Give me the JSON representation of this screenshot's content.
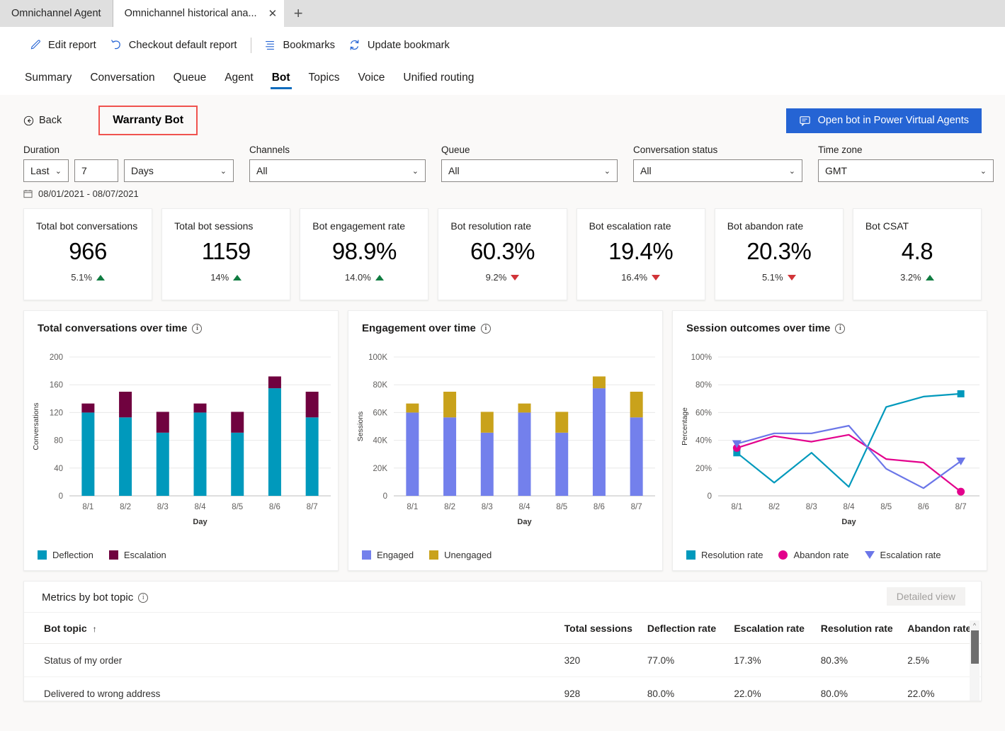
{
  "browser": {
    "tabs": [
      {
        "title": "Omnichannel Agent",
        "active": false
      },
      {
        "title": "Omnichannel historical ana...",
        "active": true
      }
    ],
    "close_glyph": "✕",
    "newtab_glyph": "+"
  },
  "commandbar": {
    "items": [
      {
        "label": "Edit report",
        "icon": "pencil-icon"
      },
      {
        "label": "Checkout default report",
        "icon": "undo-icon"
      },
      {
        "label": "Bookmarks",
        "icon": "list-icon"
      },
      {
        "label": "Update bookmark",
        "icon": "refresh-icon"
      }
    ]
  },
  "nav": {
    "tabs": [
      {
        "label": "Summary",
        "selected": false
      },
      {
        "label": "Conversation",
        "selected": false
      },
      {
        "label": "Queue",
        "selected": false
      },
      {
        "label": "Agent",
        "selected": false
      },
      {
        "label": "Bot",
        "selected": true
      },
      {
        "label": "Topics",
        "selected": false
      },
      {
        "label": "Voice",
        "selected": false
      },
      {
        "label": "Unified routing",
        "selected": false
      }
    ]
  },
  "header": {
    "back_label": "Back",
    "bot_name": "Warranty Bot",
    "open_bot_button": "Open bot in Power Virtual Agents",
    "highlight_color": "#f0534f",
    "button_color": "#2564d4"
  },
  "filters": {
    "duration": {
      "label": "Duration",
      "mode": "Last",
      "amount": "7",
      "unit": "Days"
    },
    "channels": {
      "label": "Channels",
      "value": "All"
    },
    "queue": {
      "label": "Queue",
      "value": "All"
    },
    "conversation_status": {
      "label": "Conversation status",
      "value": "All"
    },
    "time_zone": {
      "label": "Time zone",
      "value": "GMT"
    },
    "date_range": "08/01/2021 - 08/07/2021"
  },
  "kpis": [
    {
      "title": "Total bot conversations",
      "value": "966",
      "delta": "5.1%",
      "direction": "up"
    },
    {
      "title": "Total bot sessions",
      "value": "1159",
      "delta": "14%",
      "direction": "up"
    },
    {
      "title": "Bot engagement rate",
      "value": "98.9%",
      "delta": "14.0%",
      "direction": "up"
    },
    {
      "title": "Bot resolution rate",
      "value": "60.3%",
      "delta": "9.2%",
      "direction": "down"
    },
    {
      "title": "Bot escalation rate",
      "value": "19.4%",
      "delta": "16.4%",
      "direction": "down"
    },
    {
      "title": "Bot abandon rate",
      "value": "20.3%",
      "delta": "5.1%",
      "direction": "down"
    },
    {
      "title": "Bot CSAT",
      "value": "4.8",
      "delta": "3.2%",
      "direction": "up"
    }
  ],
  "chart_data": [
    {
      "type": "bar",
      "stacked": true,
      "title": "Total conversations over time",
      "xlabel": "Day",
      "ylabel": "Conversations",
      "categories": [
        "8/1",
        "8/2",
        "8/3",
        "8/4",
        "8/5",
        "8/6",
        "8/7"
      ],
      "ylim": [
        0,
        200
      ],
      "yticks": [
        0,
        40,
        80,
        120,
        160,
        200
      ],
      "ytick_labels": [
        "0",
        "40",
        "80",
        "120",
        "160",
        "200"
      ],
      "grid": true,
      "legend_position": "bottom-left",
      "series": [
        {
          "name": "Deflection",
          "color": "#0099bc",
          "marker": "square",
          "values": [
            120,
            113,
            91,
            120,
            91,
            155,
            113
          ]
        },
        {
          "name": "Escalation",
          "color": "#70023f",
          "marker": "square",
          "values": [
            13,
            37,
            30,
            13,
            30,
            17,
            37
          ]
        }
      ]
    },
    {
      "type": "bar",
      "stacked": true,
      "title": "Engagement over time",
      "xlabel": "Day",
      "ylabel": "Sessions",
      "categories": [
        "8/1",
        "8/2",
        "8/3",
        "8/4",
        "8/5",
        "8/6",
        "8/7"
      ],
      "ylim": [
        0,
        100000
      ],
      "yticks": [
        0,
        20000,
        40000,
        60000,
        80000,
        100000
      ],
      "ytick_labels": [
        "0",
        "20K",
        "40K",
        "60K",
        "80K",
        "100K"
      ],
      "grid": true,
      "legend_position": "bottom-left",
      "series": [
        {
          "name": "Engaged",
          "color": "#7380ec",
          "marker": "square",
          "values": [
            60000,
            56500,
            45500,
            60000,
            45500,
            77500,
            56500
          ]
        },
        {
          "name": "Unengaged",
          "color": "#c9a21b",
          "marker": "square",
          "values": [
            6500,
            18500,
            15000,
            6500,
            15000,
            8500,
            18500
          ]
        }
      ]
    },
    {
      "type": "line",
      "title": "Session outcomes over time",
      "xlabel": "Day",
      "ylabel": "Percentage",
      "categories": [
        "8/1",
        "8/2",
        "8/3",
        "8/4",
        "8/5",
        "8/6",
        "8/7"
      ],
      "ylim": [
        0,
        100
      ],
      "yticks": [
        0,
        20,
        40,
        60,
        80,
        100
      ],
      "ytick_labels": [
        "0",
        "20%",
        "40%",
        "60%",
        "80%",
        "100%"
      ],
      "grid": true,
      "legend_position": "bottom-left",
      "series": [
        {
          "name": "Resolution rate",
          "color": "#0099bc",
          "marker": "square",
          "values": [
            31,
            9.5,
            31,
            6.5,
            64,
            71.5,
            73.5
          ]
        },
        {
          "name": "Abandon rate",
          "color": "#e3008c",
          "marker": "circle",
          "values": [
            34.5,
            43,
            39,
            44,
            26.5,
            24,
            3
          ]
        },
        {
          "name": "Escalation rate",
          "color": "#6b76e8",
          "marker": "triangle-down",
          "values": [
            37.5,
            45,
            45,
            50.5,
            19.5,
            5.5,
            25
          ]
        }
      ]
    }
  ],
  "table": {
    "caption": "Metrics by bot topic",
    "detailed_view_button": "Detailed view",
    "sort_glyph": "↑",
    "columns": [
      "Bot topic",
      "Total sessions",
      "Deflection rate",
      "Escalation rate",
      "Resolution rate",
      "Abandon rate"
    ],
    "rows": [
      {
        "topic": "Status of my order",
        "total_sessions": "320",
        "deflection_rate": "77.0%",
        "escalation_rate": "17.3%",
        "resolution_rate": "80.3%",
        "abandon_rate": "2.5%"
      },
      {
        "topic": "Delivered to wrong address",
        "total_sessions": "928",
        "deflection_rate": "80.0%",
        "escalation_rate": "22.0%",
        "resolution_rate": "80.0%",
        "abandon_rate": "22.0%"
      }
    ]
  }
}
